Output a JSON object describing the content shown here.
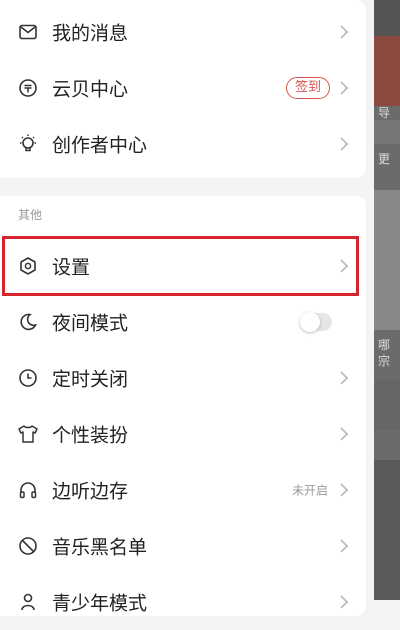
{
  "menu_group1": [
    {
      "label": "我的消息",
      "icon": "message-icon"
    },
    {
      "label": "云贝中心",
      "icon": "coin-icon",
      "badge": "签到"
    },
    {
      "label": "创作者中心",
      "icon": "lightbulb-icon"
    }
  ],
  "section_other": {
    "title": "其他"
  },
  "menu_group2": [
    {
      "label": "设置",
      "icon": "settings-icon"
    },
    {
      "label": "夜间模式",
      "icon": "moon-icon",
      "toggle": "off"
    },
    {
      "label": "定时关闭",
      "icon": "timer-icon"
    },
    {
      "label": "个性装扮",
      "icon": "tshirt-icon"
    },
    {
      "label": "边听边存",
      "icon": "headphones-icon",
      "status": "未开启"
    },
    {
      "label": "音乐黑名单",
      "icon": "block-icon"
    },
    {
      "label": "青少年模式",
      "icon": "child-icon"
    }
  ],
  "background_peek": {
    "text1": "导",
    "text2": "更",
    "text3": "哪",
    "text4": "宗"
  },
  "colors": {
    "accent": "#d6242c",
    "badge": "#d9534f",
    "muted": "#999999"
  }
}
